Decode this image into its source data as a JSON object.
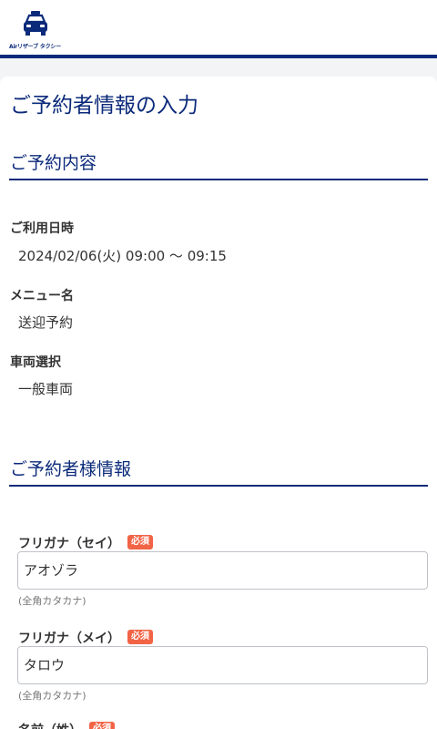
{
  "header": {
    "logo_text": "Airリザーブ タクシー",
    "accent_color": "#0b2a7a",
    "logo_icon": "taxi-icon"
  },
  "page": {
    "title": "ご予約者情報の入力"
  },
  "reservation": {
    "section_title": "ご予約内容",
    "datetime_label": "ご利用日時",
    "datetime_value": "2024/02/06(火) 09:00 〜 09:15",
    "menu_label": "メニュー名",
    "menu_value": "送迎予約",
    "vehicle_label": "車両選択",
    "vehicle_value": "一般車両"
  },
  "customer": {
    "section_title": "ご予約者様情報",
    "required_badge": "必須",
    "required_color": "#f26446",
    "kana_sei_label": "フリガナ（セイ）",
    "kana_sei_value": "アオゾラ",
    "kana_sei_hint": "(全角カタカナ)",
    "kana_mei_label": "フリガナ（メイ）",
    "kana_mei_value": "タロウ",
    "kana_mei_hint": "(全角カタカナ)",
    "name_sei_label": "名前（姓）"
  }
}
